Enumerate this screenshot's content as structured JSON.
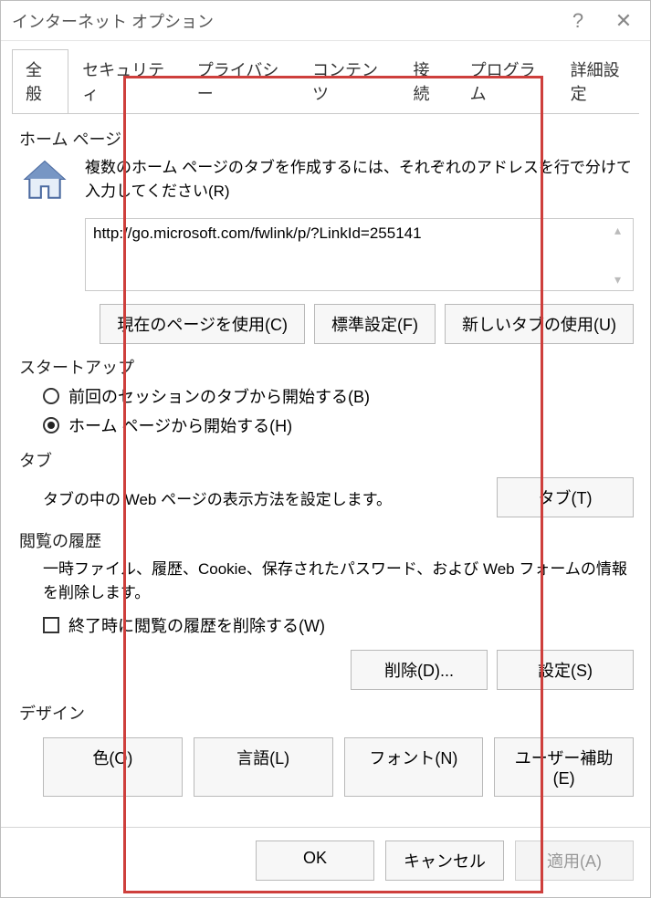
{
  "window_title": "インターネット オプション",
  "titlebar": {
    "help": "?",
    "close": "✕"
  },
  "tabs": {
    "general": "全般",
    "security": "セキュリティ",
    "privacy": "プライバシー",
    "content": "コンテンツ",
    "connections": "接続",
    "programs": "プログラム",
    "advanced": "詳細設定"
  },
  "home": {
    "group_label": "ホーム ページ",
    "desc": "複数のホーム ページのタブを作成するには、それぞれのアドレスを行で分けて入力してください(R)",
    "url": "http://go.microsoft.com/fwlink/p/?LinkId=255141",
    "btn_current": "現在のページを使用(C)",
    "btn_default": "標準設定(F)",
    "btn_newtab": "新しいタブの使用(U)"
  },
  "startup": {
    "group_label": "スタートアップ",
    "radio_last": "前回のセッションのタブから開始する(B)",
    "radio_home": "ホーム ページから開始する(H)"
  },
  "tabs_section": {
    "group_label": "タブ",
    "desc": "タブの中の Web ページの表示方法を設定します。",
    "btn": "タブ(T)"
  },
  "history": {
    "group_label": "閲覧の履歴",
    "desc": "一時ファイル、履歴、Cookie、保存されたパスワード、および Web フォームの情報を削除します。",
    "check": "終了時に閲覧の履歴を削除する(W)",
    "btn_delete": "削除(D)...",
    "btn_settings": "設定(S)"
  },
  "design": {
    "group_label": "デザイン",
    "btn_color": "色(O)",
    "btn_lang": "言語(L)",
    "btn_font": "フォント(N)",
    "btn_acc": "ユーザー補助(E)"
  },
  "footer": {
    "ok": "OK",
    "cancel": "キャンセル",
    "apply": "適用(A)"
  }
}
